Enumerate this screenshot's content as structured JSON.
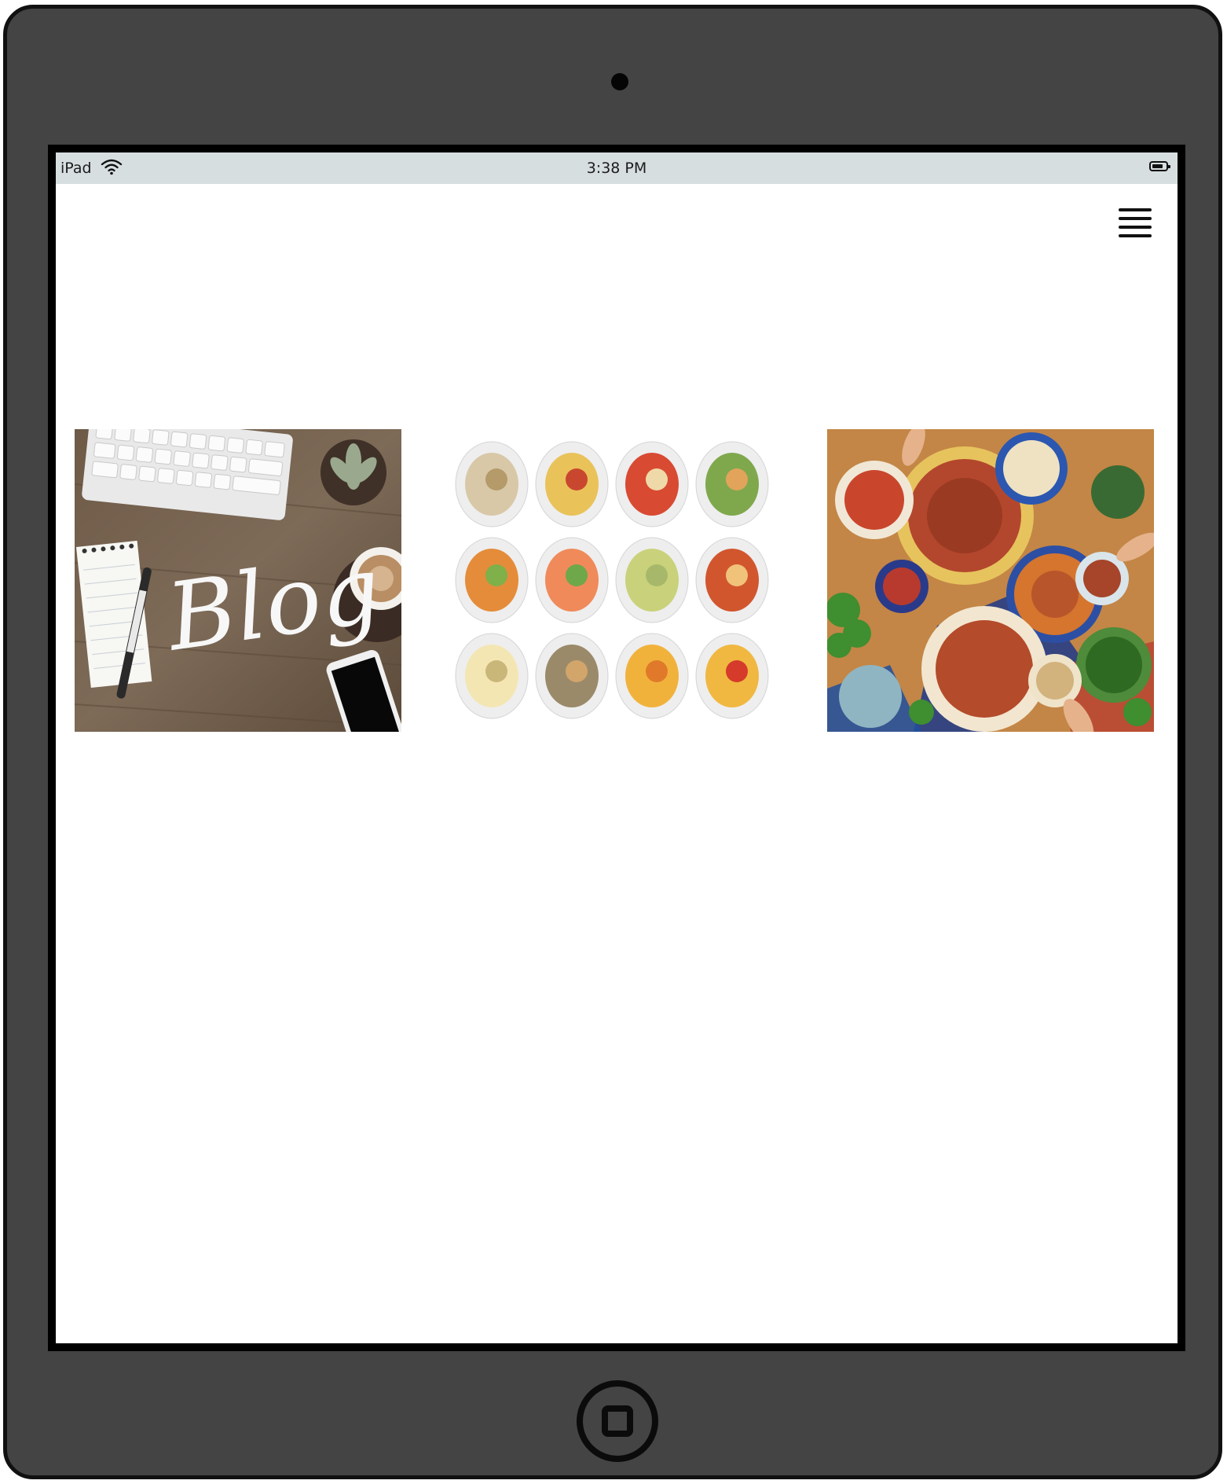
{
  "device": {
    "name": "iPad"
  },
  "status_bar": {
    "carrier": "iPad",
    "time": "3:38 PM",
    "wifi_icon": "wifi-icon",
    "battery_icon": "battery-icon"
  },
  "header": {
    "menu_icon": "hamburger-menu-icon"
  },
  "gallery": {
    "items": [
      {
        "name": "blog-thumbnail",
        "caption_text": "Blog"
      },
      {
        "name": "dishes-grid-thumbnail"
      },
      {
        "name": "feast-table-thumbnail"
      }
    ]
  },
  "colors": {
    "device_body": "#444444",
    "status_bar": "#d7dee0",
    "screen_bg": "#ffffff"
  }
}
